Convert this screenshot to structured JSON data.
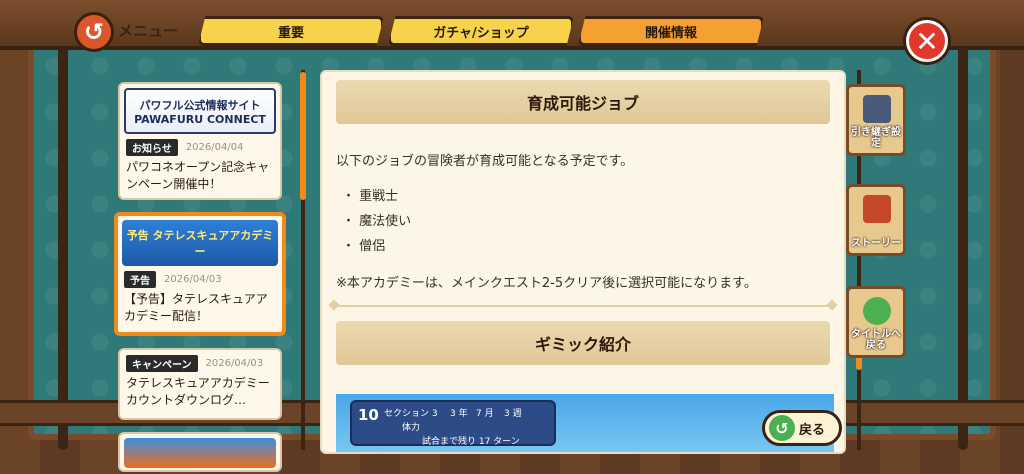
{
  "header": {
    "menu_label": "メニュー",
    "back_icon": "↺",
    "close_icon": "✕"
  },
  "tabs": [
    {
      "label": "重要",
      "active": false
    },
    {
      "label": "ガチャ/ショップ",
      "active": false
    },
    {
      "label": "開催情報",
      "active": true
    }
  ],
  "cards": [
    {
      "banner": "パワフル公式情報サイト PAWAFURU CONNECT",
      "tag": "お知らせ",
      "date": "2026/04/04",
      "text": "パワコネオープン記念キャンペーン開催中！"
    },
    {
      "banner": "予告 タテレスキュアアカデミー",
      "tag": "予告",
      "date": "2026/04/03",
      "text": "【予告】タテレスキュアアカデミー配信！"
    },
    {
      "banner": "",
      "tag": "キャンペーン",
      "date": "2026/04/03",
      "text": "タテレスキュアアカデミーカウントダウンログ…"
    }
  ],
  "panel": {
    "section1_title": "育成可能ジョブ",
    "intro": "以下のジョブの冒険者が育成可能となる予定です。",
    "jobs": [
      "・ 重戦士",
      "・ 魔法使い",
      "・ 僧侶"
    ],
    "note": "※本アカデミーは、メインクエスト2-5クリア後に選択可能になります。",
    "section2_title": "ギミック紹介",
    "hud": {
      "turns": "10",
      "section": "セクション 3",
      "year": "3 年",
      "month": "7 月",
      "week": "3 週",
      "hp_label": "体力",
      "remaining": "試合まで残り 17 ターン"
    }
  },
  "side_buttons": [
    "引き継ぎ設定",
    "ストーリー",
    "タイトルへ戻る"
  ],
  "bottom": {
    "back_label": "戻る"
  }
}
